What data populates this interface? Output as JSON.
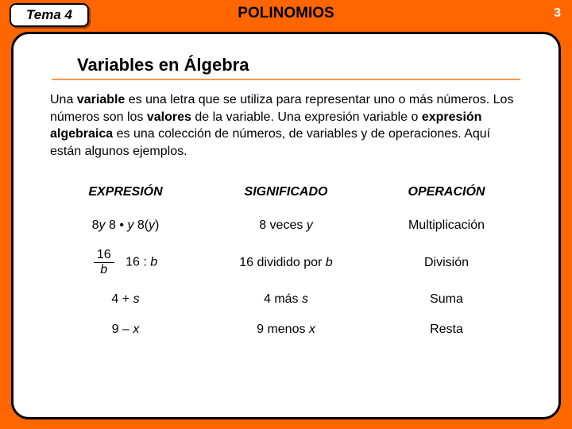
{
  "header": {
    "badge": "Tema 4",
    "title": "POLINOMIOS",
    "page_number": "3"
  },
  "section": {
    "heading": "Variables en Álgebra"
  },
  "body": {
    "p1_a": "Una ",
    "p1_b": "variable",
    "p1_c": " es una letra que se utiliza para representar uno o más números. Los números son los ",
    "p1_d": "valores",
    "p1_e": " de la variable. Una expresión variable o ",
    "p1_f": "expresión algebraica",
    "p1_g": " es una colección de números, de variables y de operaciones. Aquí están algunos ejemplos."
  },
  "table": {
    "headers": {
      "c1": "EXPRESIÓN",
      "c2": "SIGNIFICADO",
      "c3": "OPERACIÓN"
    },
    "rows": [
      {
        "expr_parts": {
          "a": "8",
          "b": "y",
          "c": "   8 • ",
          "d": "y",
          "e": "   8(",
          "f": "y",
          "g": ")"
        },
        "meaning_a": "8 veces ",
        "meaning_b": "y",
        "operation": "Multiplicación"
      },
      {
        "frac_num": "16",
        "frac_den": "b",
        "expr2_a": "16 : ",
        "expr2_b": "b",
        "meaning_a": "16 dividido por ",
        "meaning_b": "b",
        "operation": "División"
      },
      {
        "expr_a": "4 + ",
        "expr_b": "s",
        "meaning_a": "4 más ",
        "meaning_b": "s",
        "operation": "Suma"
      },
      {
        "expr_a": "9 – ",
        "expr_b": "x",
        "meaning_a": "9 menos ",
        "meaning_b": "x",
        "operation": "Resta"
      }
    ]
  }
}
